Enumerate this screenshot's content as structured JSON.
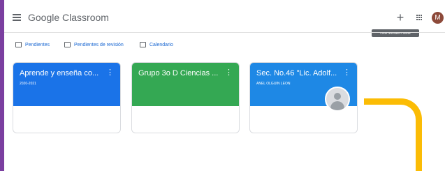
{
  "app": {
    "logo_google": "Google",
    "logo_product": "Classroom"
  },
  "header": {
    "create_tooltip": "Crear una clase o unirse",
    "avatar_initial": "M"
  },
  "subnav": {
    "items": [
      {
        "label": "Pendientes",
        "icon": "todo-icon"
      },
      {
        "label": "Pendientes de revisión",
        "icon": "review-icon"
      },
      {
        "label": "Calendario",
        "icon": "calendar-icon"
      }
    ]
  },
  "classes": [
    {
      "title": "Aprende y enseña co...",
      "subtitle": "2020-2021",
      "color": "#1a73e8"
    },
    {
      "title": "Grupo 3o D Ciencias ...",
      "subtitle": "",
      "color": "#34a853"
    },
    {
      "title": "Sec. No.46 \"Lic. Adolf...",
      "subtitle": "ANEL OLGUIN LEON",
      "color": "#1e88e5"
    }
  ],
  "colors": {
    "accent_bar": "#7b3fa0",
    "highlight_bracket": "#fbbc05"
  }
}
